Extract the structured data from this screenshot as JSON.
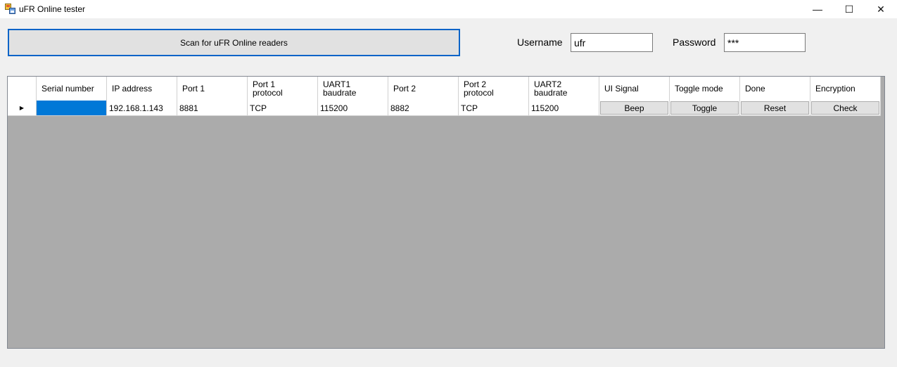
{
  "window": {
    "title": "uFR Online tester",
    "minimize_glyph": "—",
    "maximize_glyph": "☐",
    "close_glyph": "✕"
  },
  "toolbar": {
    "scan_label": "Scan for uFR Online readers",
    "username_label": "Username",
    "username_value": "ufr",
    "password_label": "Password",
    "password_value": "***"
  },
  "grid": {
    "columns": [
      "Serial number",
      "IP address",
      "Port 1",
      "Port 1\nprotocol",
      "UART1\nbaudrate",
      "Port 2",
      "Port 2\nprotocol",
      "UART2\nbaudrate",
      "UI Signal",
      "Toggle mode",
      "Done",
      "Encryption"
    ],
    "rows": [
      {
        "row_marker": "▶",
        "serial": "",
        "ip": "192.168.1.143",
        "port1": "8881",
        "port1_protocol": "TCP",
        "uart1_baudrate": "115200",
        "port2": "8882",
        "port2_protocol": "TCP",
        "uart2_baudrate": "115200",
        "ui_signal": "Beep",
        "toggle_mode": "Toggle",
        "done": "Reset",
        "encryption": "Check"
      }
    ]
  },
  "colors": {
    "selection": "#0078d7",
    "grid_background": "#ababab",
    "focus_border": "#0a64c8"
  }
}
